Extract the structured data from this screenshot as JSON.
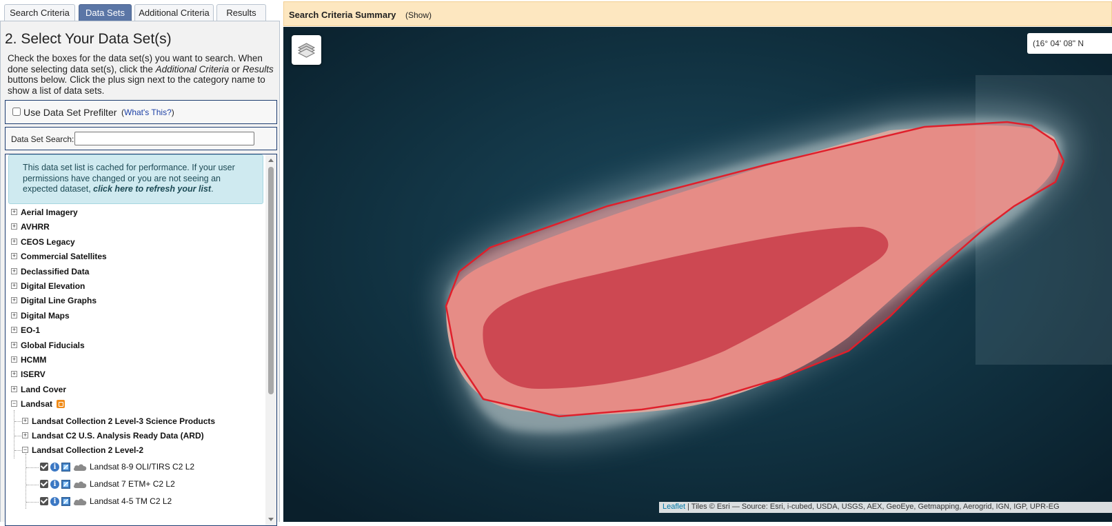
{
  "tabs": [
    {
      "label": "Search Criteria"
    },
    {
      "label": "Data Sets"
    },
    {
      "label": "Additional Criteria"
    },
    {
      "label": "Results"
    }
  ],
  "section": {
    "title": "2. Select Your Data Set(s)",
    "instructions_part1": "Check the boxes for the data set(s) you want to search. When done selecting data set(s), click the ",
    "instructions_em1": "Additional Criteria",
    "instructions_or": " or ",
    "instructions_em2": "Results",
    "instructions_part2": " buttons below. Click the plus sign next to the category name to show a list of data sets."
  },
  "prefilter": {
    "label": "Use Data Set Prefilter",
    "whats_this_open": "(",
    "whats_this_link": "What's This?",
    "whats_this_close": ")"
  },
  "dataset_search": {
    "label": "Data Set Search:",
    "value": ""
  },
  "cache_notice": {
    "text": "This data set list is cached for performance. If your user permissions have changed or you are not seeing an expected dataset, ",
    "link": "click here to refresh your list",
    "end": "."
  },
  "categories": [
    "Aerial Imagery",
    "AVHRR",
    "CEOS Legacy",
    "Commercial Satellites",
    "Declassified Data",
    "Digital Elevation",
    "Digital Line Graphs",
    "Digital Maps",
    "EO-1",
    "Global Fiducials",
    "HCMM",
    "ISERV",
    "Land Cover",
    "Landsat"
  ],
  "landsat_children": [
    "Landsat Collection 2 Level-3 Science Products",
    "Landsat C2 U.S. Analysis Ready Data (ARD)",
    "Landsat Collection 2 Level-2"
  ],
  "level2_datasets": [
    "Landsat 8-9 OLI/TIRS C2 L2",
    "Landsat 7 ETM+ C2 L2",
    "Landsat 4-5 TM C2 L2"
  ],
  "summary": {
    "title": "Search Criteria Summary",
    "toggle": "(Show)"
  },
  "map": {
    "coordinates": "(16° 04' 08\" N",
    "attribution_link": "Leaflet",
    "attribution_text": " | Tiles © Esri — Source: Esri, i-cubed, USDA, USGS, AEX, GeoEye, Getmapping, Aerogrid, IGN, IGP, UPR-EG"
  },
  "colors": {
    "active_tab": "#5b76a6",
    "summary_bar": "#fde7c0",
    "polygon_stroke": "#e01f2b",
    "polygon_fill": "#ff5a5a"
  }
}
